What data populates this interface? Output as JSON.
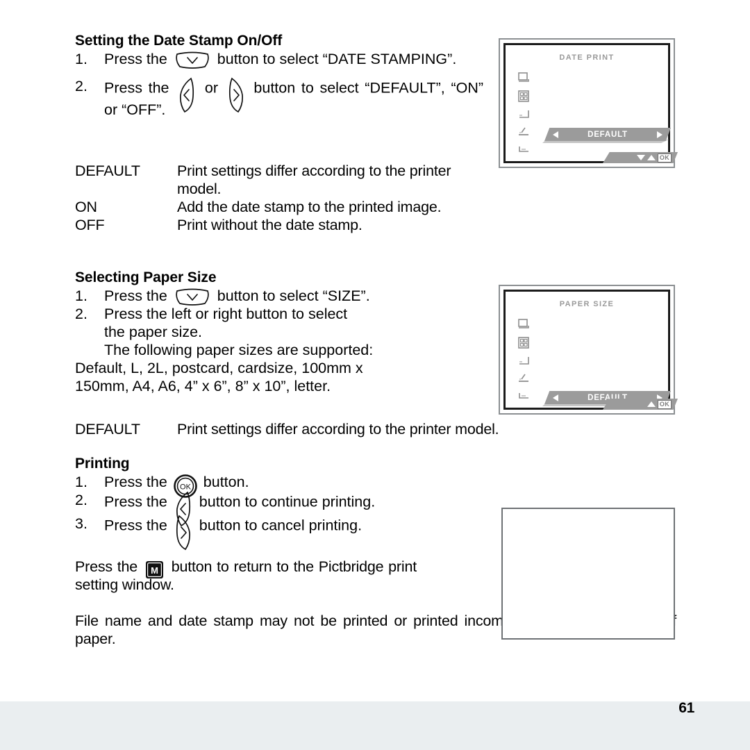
{
  "page": {
    "number": "61",
    "background": "#ffffff",
    "footer_band_color": "#eaeef0"
  },
  "sections": {
    "date_stamp": {
      "heading": "Setting the Date Stamp On/Off",
      "steps": [
        {
          "num": "1.",
          "before": "Press the",
          "icon": "down-button-icon",
          "after": "button to select “DATE STAMPING”."
        },
        {
          "num": "2.",
          "before": "Press  the",
          "icon_left": "left-button-icon",
          "middle": "or",
          "icon_right": "right-button-icon",
          "after": "button  to  select “DEFAULT”, “ON” or “OFF”."
        }
      ]
    },
    "date_stamp_options": {
      "rows": [
        {
          "term": "DEFAULT",
          "desc": "Print settings differ according to the printer model."
        },
        {
          "term": "ON",
          "desc": "Add the date stamp to the printed image."
        },
        {
          "term": "OFF",
          "desc": "Print without the date stamp."
        }
      ]
    },
    "paper_size": {
      "heading": "Selecting Paper Size",
      "steps": [
        {
          "num": "1.",
          "before": "Press the",
          "icon": "down-button-icon",
          "after": "button to select “SIZE”."
        },
        {
          "num": "2.",
          "lines": [
            "Press the left or right button to select",
            "the paper size.",
            "The following paper sizes are supported:",
            "Default,  L,  2L,  postcard,  cardsize,  100mm  x",
            "150mm, A4, A6, 4” x 6”, 8” x 10”, letter."
          ]
        }
      ]
    },
    "paper_size_options": {
      "rows": [
        {
          "term": "DEFAULT",
          "desc": "Print settings differ according to the printer model."
        }
      ]
    },
    "printing": {
      "heading": "Printing",
      "steps": [
        {
          "num": "1.",
          "before": "Press the",
          "icon": "ok-button-icon",
          "after": "button."
        },
        {
          "num": "2.",
          "before": "Press the",
          "icon": "left-button-icon",
          "after": "button to continue printing."
        },
        {
          "num": "3.",
          "before": "Press the",
          "icon": "right-button-icon",
          "after": "button to cancel printing."
        }
      ],
      "note_return": {
        "before": "Press  the",
        "icon": "menu-m-button-icon",
        "after": "button  to  return  to  the Pictbridge print setting window."
      },
      "note_warning": "File  name  and  date  stamp  may  not  be  printed  or  printed  incompletely  on certain sizes of paper."
    }
  },
  "lcd_screens": [
    {
      "id": "date-print-screen",
      "title": "DATE PRINT",
      "selected_value": "DEFAULT",
      "arrow_left": "◀",
      "arrow_right": "▶",
      "ok_label": "OK",
      "menu_icons": [
        "print-layout-icon",
        "multi-frame-icon",
        "paper-size-icon",
        "date-print-icon",
        "file-name-icon"
      ]
    },
    {
      "id": "paper-size-screen",
      "title": "PAPER SIZE",
      "selected_value": "DEFAULT",
      "arrow_left": "◀",
      "arrow_right": "▶",
      "ok_label": "OK",
      "menu_icons": [
        "print-layout-icon",
        "multi-frame-icon",
        "paper-size-icon",
        "date-print-icon",
        "file-name-icon"
      ]
    }
  ],
  "colors": {
    "lcd_gray": "#9b9b9b",
    "lcd_title_gray": "#9a9a9a",
    "frame_gray": "#8b8f92",
    "frame_black": "#1b1b1b"
  }
}
